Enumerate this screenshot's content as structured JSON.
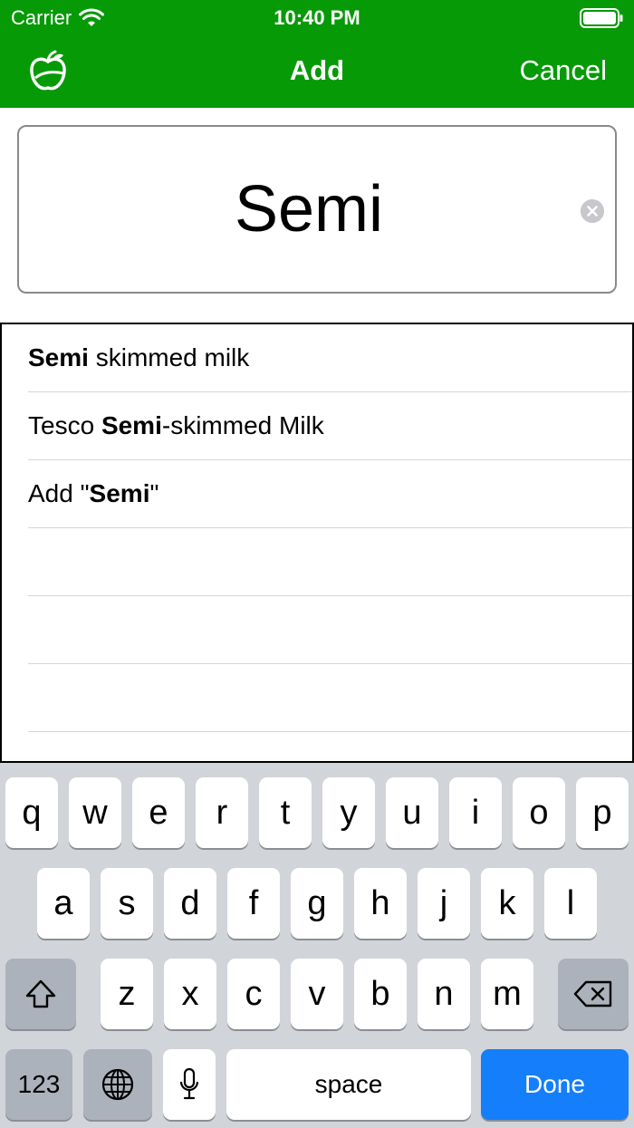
{
  "status_bar": {
    "carrier": "Carrier",
    "time": "10:40 PM"
  },
  "nav": {
    "title": "Add",
    "cancel_label": "Cancel",
    "logo_icon": "apple-logo-icon"
  },
  "search": {
    "value": "Semi",
    "clear_icon": "clear-circle-icon"
  },
  "suggestions": [
    {
      "prefix": "",
      "bold": "Semi",
      "suffix": " skimmed milk"
    },
    {
      "prefix": "Tesco ",
      "bold": "Semi",
      "suffix": "-skimmed Milk"
    },
    {
      "prefix": "Add \"",
      "bold": "Semi",
      "suffix": "\""
    }
  ],
  "keyboard": {
    "row1": [
      "q",
      "w",
      "e",
      "r",
      "t",
      "y",
      "u",
      "i",
      "o",
      "p"
    ],
    "row2": [
      "a",
      "s",
      "d",
      "f",
      "g",
      "h",
      "j",
      "k",
      "l"
    ],
    "row3": [
      "z",
      "x",
      "c",
      "v",
      "b",
      "n",
      "m"
    ],
    "numbers_label": "123",
    "space_label": "space",
    "done_label": "Done"
  },
  "colors": {
    "header_green": "#079a07",
    "done_blue": "#147efb",
    "keyboard_bg": "#d1d4d9"
  }
}
